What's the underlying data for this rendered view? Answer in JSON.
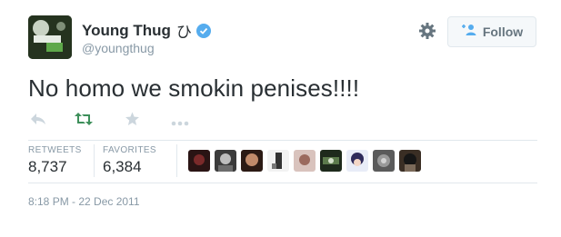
{
  "profile": {
    "display_name": "Young Thug",
    "name_glyph": "ひ",
    "handle": "@youngthug"
  },
  "follow_button": {
    "label": "Follow"
  },
  "tweet": {
    "text": "No homo we smokin penises!!!!",
    "timestamp": "8:18 PM - 22 Dec 2011"
  },
  "stats": {
    "retweets_label": "RETWEETS",
    "retweets_value": "8,737",
    "favorites_label": "FAVORITES",
    "favorites_value": "6,384"
  },
  "actions": [
    "reply-icon",
    "retweet-icon",
    "favorite-icon",
    "more-icon"
  ],
  "colors": {
    "verified": "#55acee",
    "retweet_active": "#3d8f5a",
    "muted": "#8899a6",
    "text": "#292f33"
  }
}
